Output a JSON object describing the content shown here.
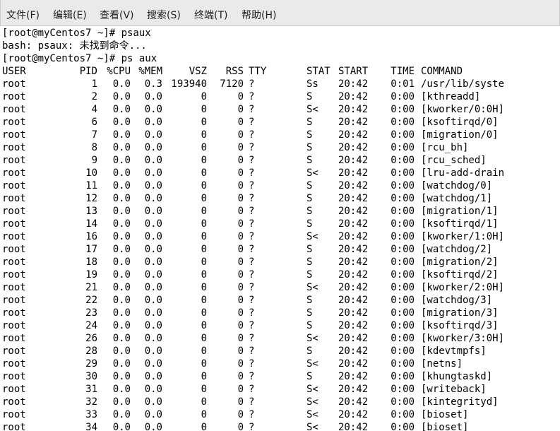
{
  "menubar": {
    "items": [
      {
        "label": "文件(F)"
      },
      {
        "label": "编辑(E)"
      },
      {
        "label": "查看(V)"
      },
      {
        "label": "搜索(S)"
      },
      {
        "label": "终端(T)"
      },
      {
        "label": "帮助(H)"
      }
    ]
  },
  "terminal": {
    "lines": [
      "[root@myCentos7 ~]# psaux",
      "bash: psaux: 未找到命令...",
      "[root@myCentos7 ~]# ps aux"
    ],
    "table": {
      "headers": [
        "USER",
        "PID",
        "%CPU",
        "%MEM",
        "VSZ",
        "RSS",
        "TTY",
        "STAT",
        "START",
        "TIME",
        "COMMAND"
      ],
      "rows": [
        [
          "root",
          "1",
          "0.0",
          "0.3",
          "193940",
          "7120",
          "?",
          "Ss",
          "20:42",
          "0:01",
          "/usr/lib/syste"
        ],
        [
          "root",
          "2",
          "0.0",
          "0.0",
          "0",
          "0",
          "?",
          "S",
          "20:42",
          "0:00",
          "[kthreadd]"
        ],
        [
          "root",
          "4",
          "0.0",
          "0.0",
          "0",
          "0",
          "?",
          "S<",
          "20:42",
          "0:00",
          "[kworker/0:0H]"
        ],
        [
          "root",
          "6",
          "0.0",
          "0.0",
          "0",
          "0",
          "?",
          "S",
          "20:42",
          "0:00",
          "[ksoftirqd/0]"
        ],
        [
          "root",
          "7",
          "0.0",
          "0.0",
          "0",
          "0",
          "?",
          "S",
          "20:42",
          "0:00",
          "[migration/0]"
        ],
        [
          "root",
          "8",
          "0.0",
          "0.0",
          "0",
          "0",
          "?",
          "S",
          "20:42",
          "0:00",
          "[rcu_bh]"
        ],
        [
          "root",
          "9",
          "0.0",
          "0.0",
          "0",
          "0",
          "?",
          "S",
          "20:42",
          "0:00",
          "[rcu_sched]"
        ],
        [
          "root",
          "10",
          "0.0",
          "0.0",
          "0",
          "0",
          "?",
          "S<",
          "20:42",
          "0:00",
          "[lru-add-drain"
        ],
        [
          "root",
          "11",
          "0.0",
          "0.0",
          "0",
          "0",
          "?",
          "S",
          "20:42",
          "0:00",
          "[watchdog/0]"
        ],
        [
          "root",
          "12",
          "0.0",
          "0.0",
          "0",
          "0",
          "?",
          "S",
          "20:42",
          "0:00",
          "[watchdog/1]"
        ],
        [
          "root",
          "13",
          "0.0",
          "0.0",
          "0",
          "0",
          "?",
          "S",
          "20:42",
          "0:00",
          "[migration/1]"
        ],
        [
          "root",
          "14",
          "0.0",
          "0.0",
          "0",
          "0",
          "?",
          "S",
          "20:42",
          "0:00",
          "[ksoftirqd/1]"
        ],
        [
          "root",
          "16",
          "0.0",
          "0.0",
          "0",
          "0",
          "?",
          "S<",
          "20:42",
          "0:00",
          "[kworker/1:0H]"
        ],
        [
          "root",
          "17",
          "0.0",
          "0.0",
          "0",
          "0",
          "?",
          "S",
          "20:42",
          "0:00",
          "[watchdog/2]"
        ],
        [
          "root",
          "18",
          "0.0",
          "0.0",
          "0",
          "0",
          "?",
          "S",
          "20:42",
          "0:00",
          "[migration/2]"
        ],
        [
          "root",
          "19",
          "0.0",
          "0.0",
          "0",
          "0",
          "?",
          "S",
          "20:42",
          "0:00",
          "[ksoftirqd/2]"
        ],
        [
          "root",
          "21",
          "0.0",
          "0.0",
          "0",
          "0",
          "?",
          "S<",
          "20:42",
          "0:00",
          "[kworker/2:0H]"
        ],
        [
          "root",
          "22",
          "0.0",
          "0.0",
          "0",
          "0",
          "?",
          "S",
          "20:42",
          "0:00",
          "[watchdog/3]"
        ],
        [
          "root",
          "23",
          "0.0",
          "0.0",
          "0",
          "0",
          "?",
          "S",
          "20:42",
          "0:00",
          "[migration/3]"
        ],
        [
          "root",
          "24",
          "0.0",
          "0.0",
          "0",
          "0",
          "?",
          "S",
          "20:42",
          "0:00",
          "[ksoftirqd/3]"
        ],
        [
          "root",
          "26",
          "0.0",
          "0.0",
          "0",
          "0",
          "?",
          "S<",
          "20:42",
          "0:00",
          "[kworker/3:0H]"
        ],
        [
          "root",
          "28",
          "0.0",
          "0.0",
          "0",
          "0",
          "?",
          "S",
          "20:42",
          "0:00",
          "[kdevtmpfs]"
        ],
        [
          "root",
          "29",
          "0.0",
          "0.0",
          "0",
          "0",
          "?",
          "S<",
          "20:42",
          "0:00",
          "[netns]"
        ],
        [
          "root",
          "30",
          "0.0",
          "0.0",
          "0",
          "0",
          "?",
          "S",
          "20:42",
          "0:00",
          "[khungtaskd]"
        ],
        [
          "root",
          "31",
          "0.0",
          "0.0",
          "0",
          "0",
          "?",
          "S<",
          "20:42",
          "0:00",
          "[writeback]"
        ],
        [
          "root",
          "32",
          "0.0",
          "0.0",
          "0",
          "0",
          "?",
          "S<",
          "20:42",
          "0:00",
          "[kintegrityd]"
        ],
        [
          "root",
          "33",
          "0.0",
          "0.0",
          "0",
          "0",
          "?",
          "S<",
          "20:42",
          "0:00",
          "[bioset]"
        ],
        [
          "root",
          "34",
          "0.0",
          "0.0",
          "0",
          "0",
          "?",
          "S<",
          "20:42",
          "0:00",
          "[bioset]"
        ]
      ]
    }
  }
}
